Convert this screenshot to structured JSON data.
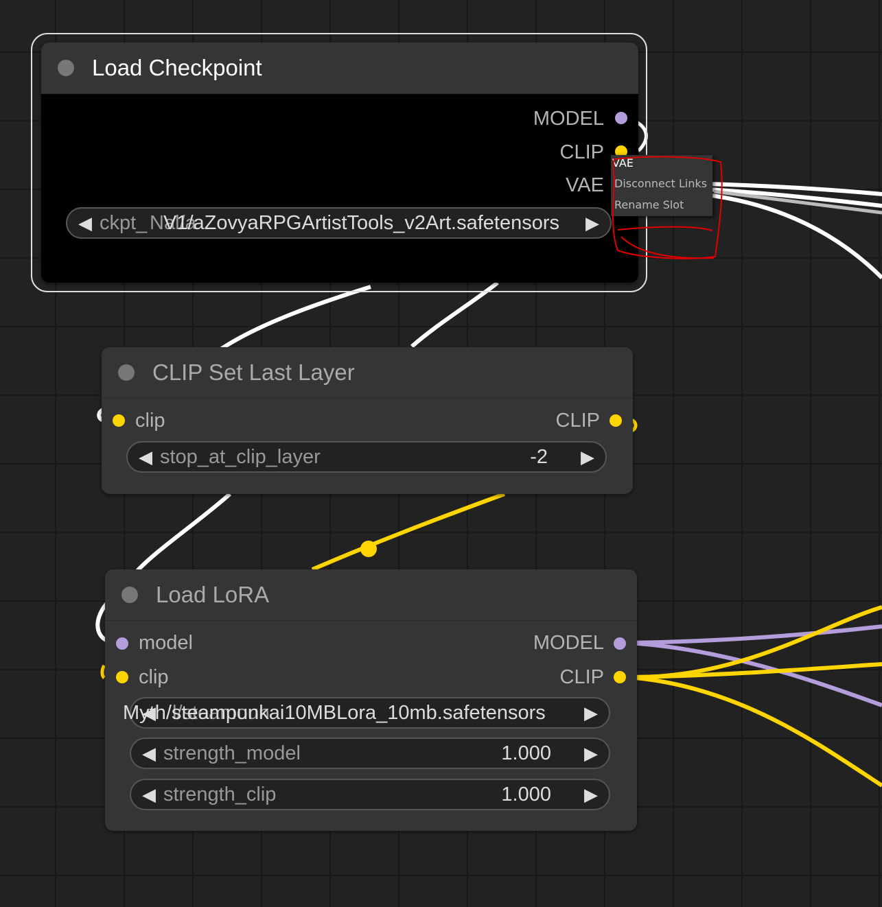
{
  "colors": {
    "canvas_bg": "#222222",
    "node_bg": "#353535",
    "clip_link": "#ffd500",
    "model_link": "#b39ddb",
    "vae_link": "#ffffff",
    "annotation": "#e00000"
  },
  "load_checkpoint": {
    "title": "Load Checkpoint",
    "outputs": [
      "MODEL",
      "CLIP",
      "VAE"
    ],
    "ckpt_label": "ckpt_",
    "ckpt_value": "V1/aZovyaRPGArtistTools_v2Art.safetensors",
    "ckpt_ghost": "Nal/a"
  },
  "context_menu": {
    "title": "VAE",
    "items": [
      "Disconnect Links",
      "Rename Slot"
    ]
  },
  "clip_set_last_layer": {
    "title": "CLIP Set Last Layer",
    "input": "clip",
    "output": "CLIP",
    "widget_name": "stop_at_clip_layer",
    "widget_value": "-2"
  },
  "load_lora": {
    "title": "Load LoRA",
    "inputs": [
      "model",
      "clip"
    ],
    "outputs": [
      "MODEL",
      "CLIP"
    ],
    "lora_value": "Myth/steampunkai10MBLora_10mb.safetensors",
    "lora_ghost": "l/steamoun",
    "strength_model_label": "strength_model",
    "strength_model_value": "1.000",
    "strength_clip_label": "strength_clip",
    "strength_clip_value": "1.000"
  }
}
